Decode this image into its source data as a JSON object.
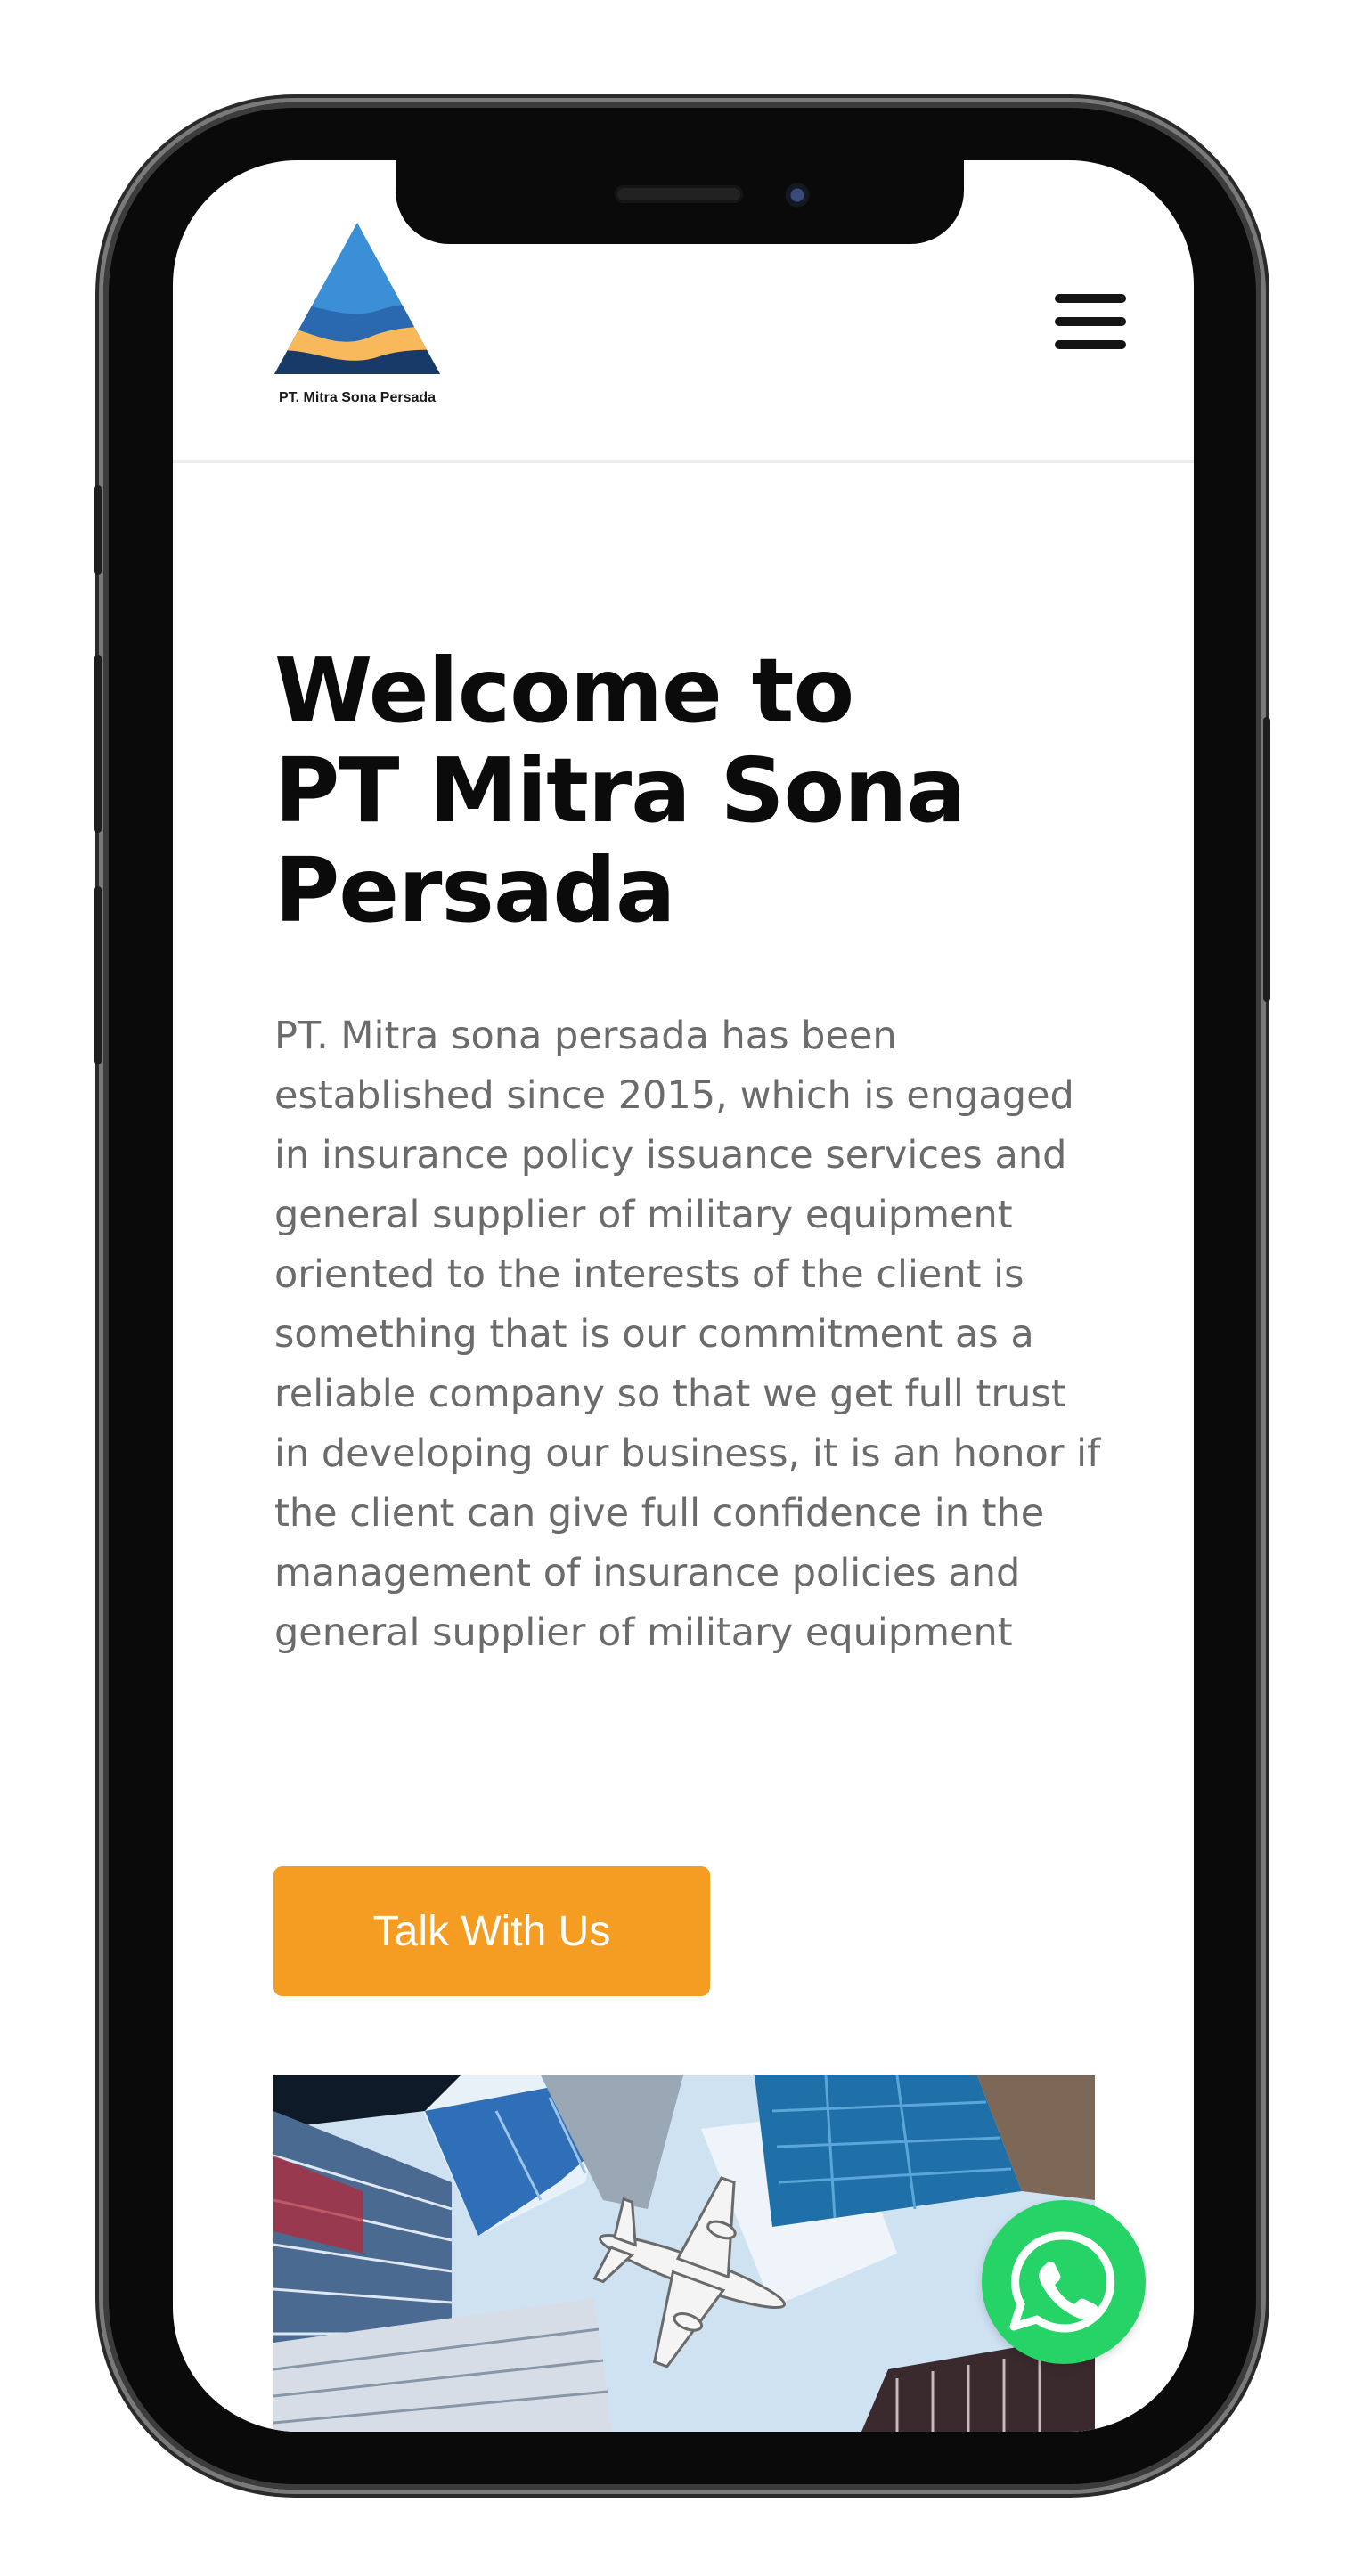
{
  "brand": {
    "logo_text": "PT. Mitra Sona Persada",
    "colors": {
      "navy": "#183a68",
      "sky": "#3b8fd6",
      "gold": "#f7b95a"
    }
  },
  "header": {
    "menu_icon": "hamburger-menu-icon"
  },
  "hero": {
    "title_lines": [
      "Welcome to",
      "PT Mitra Sona",
      "Persada"
    ],
    "description": "PT. Mitra sona persada has been established since 2015, which is engaged in insurance policy issuance services and general supplier of military equipment oriented to the interests of the client is something that is our commitment as a reliable company so that we get full trust in developing our business, it is an honor if the client can give full confidence in the management of insurance policies and general supplier of military equipment",
    "cta_label": "Talk With Us",
    "cta_color": "#f59c23",
    "image_icon": "city-skyline-airplane-image"
  },
  "whatsapp": {
    "icon": "whatsapp-icon",
    "color": "#25d366"
  }
}
